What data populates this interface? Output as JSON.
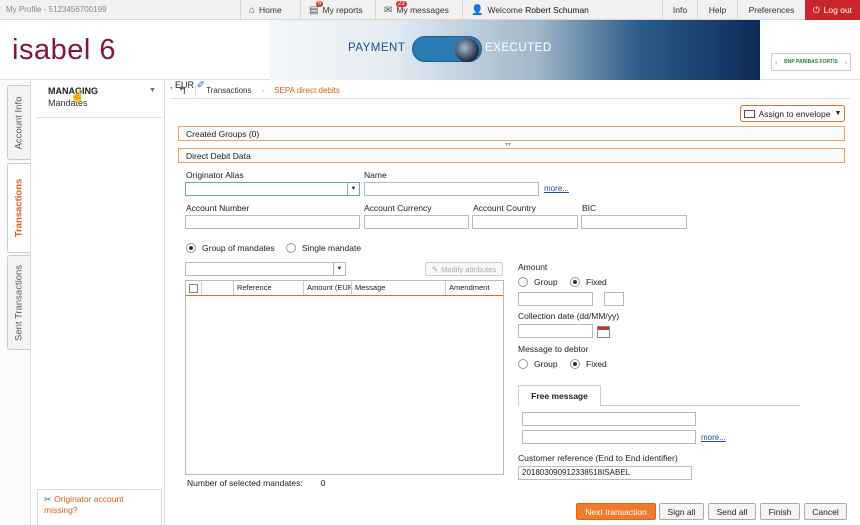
{
  "topbar": {
    "profile": "My Profile - 5123456700199",
    "home": "Home",
    "reports": "My reports",
    "reports_badge": "6",
    "messages": "My messages",
    "messages_badge": "23",
    "welcome": "Welcome",
    "user": "Robert Schuman",
    "info": "Info",
    "help": "Help",
    "preferences": "Preferences",
    "logout": "Log out"
  },
  "header": {
    "logo": "isabel 6",
    "payment": "PAYMENT",
    "executed": "EXECUTED",
    "bank": "BNP PARIBAS FORTIS"
  },
  "vtabs": [
    "Account Info",
    "Transactions",
    "Sent Transactions"
  ],
  "leftpanel": {
    "managing": "MANAGING",
    "mandates": "Mandates",
    "originator_missing": "Originator account missing?"
  },
  "breadcrumb": [
    "Transactions",
    "SEPA direct debits"
  ],
  "assign": "Assign to envelope",
  "sections": {
    "created_groups": "Created Groups (0)",
    "direct_debit": "Direct Debit Data"
  },
  "form": {
    "originator_alias": "Originator Alias",
    "name": "Name",
    "more": "more...",
    "account_number": "Account Number",
    "account_currency": "Account Currency",
    "account_country": "Account Country",
    "bic": "BIC",
    "group_of_mandates": "Group of mandates",
    "single_mandate": "Single mandate",
    "modify_attributes": "Modify attributes",
    "amount": "Amount",
    "group": "Group",
    "fixed": "Fixed",
    "comma": ",",
    "currency": "EUR",
    "collection_date": "Collection date (dd/MM/yy)",
    "message_to_debtor": "Message to debtor",
    "free_message": "Free message",
    "more2": "more...",
    "customer_reference": "Customer reference (End to End identifier)",
    "customer_reference_value": "20180309091233851​8ISABEL",
    "number_selected": "Number of selected mandates:",
    "number_selected_value": "0"
  },
  "grid_headers": [
    "",
    "",
    "Reference",
    "Amount (EUR)",
    "Message",
    "Amendment"
  ],
  "buttons": {
    "next": "Next transaction",
    "sign_all": "Sign all",
    "send_all": "Send all",
    "finish": "Finish",
    "cancel": "Cancel"
  },
  "colors": {
    "accent": "#f07a2c",
    "brand": "#8a1538",
    "logout": "#c8262b"
  }
}
